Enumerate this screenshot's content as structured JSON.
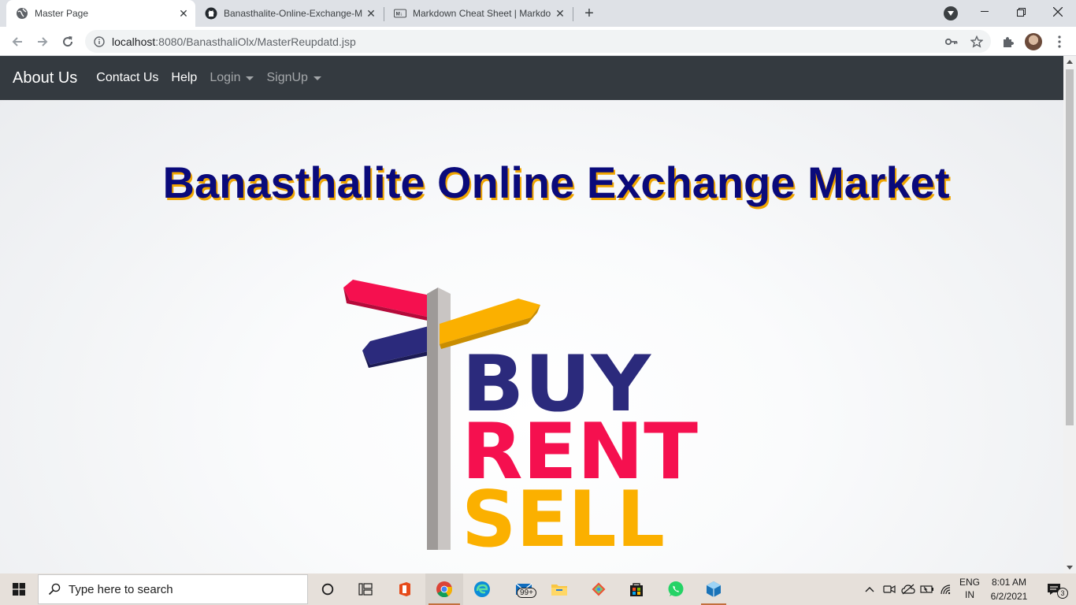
{
  "browser": {
    "tabs": [
      {
        "title": "Master Page",
        "active": true,
        "favicon": "globe-icon"
      },
      {
        "title": "Banasthalite-Online-Exchange-M",
        "active": false,
        "favicon": "github-icon"
      },
      {
        "title": "Markdown Cheat Sheet | Markdo",
        "active": false,
        "favicon": "markdown-icon"
      }
    ],
    "new_tab_label": "+",
    "url_host": "localhost",
    "url_rest": ":8080/BanasthaliOlx/MasterReupdatd.jsp"
  },
  "site": {
    "navbar": {
      "brand": "About Us",
      "links": [
        {
          "label": "Contact Us"
        },
        {
          "label": "Help"
        },
        {
          "label": "Login"
        },
        {
          "label": "SignUp"
        }
      ]
    },
    "heading": "Banasthalite Online Exchange Market",
    "logo": {
      "words": [
        "BUY",
        "RENT",
        "SELL"
      ],
      "colors": {
        "buy": "#2b2a7c",
        "rent": "#f5104f",
        "sell": "#fbb000"
      }
    }
  },
  "taskbar": {
    "search_placeholder": "Type here to search",
    "mail_badge": "99+",
    "language": "ENG",
    "region": "IN",
    "time": "8:01 AM",
    "date": "6/2/2021",
    "notifications": "3"
  },
  "colors": {
    "navbar_bg": "#343a40",
    "title_color": "#0a0a7a",
    "title_shadow": "#f0a500",
    "taskbar_bg": "#e6e0da"
  }
}
